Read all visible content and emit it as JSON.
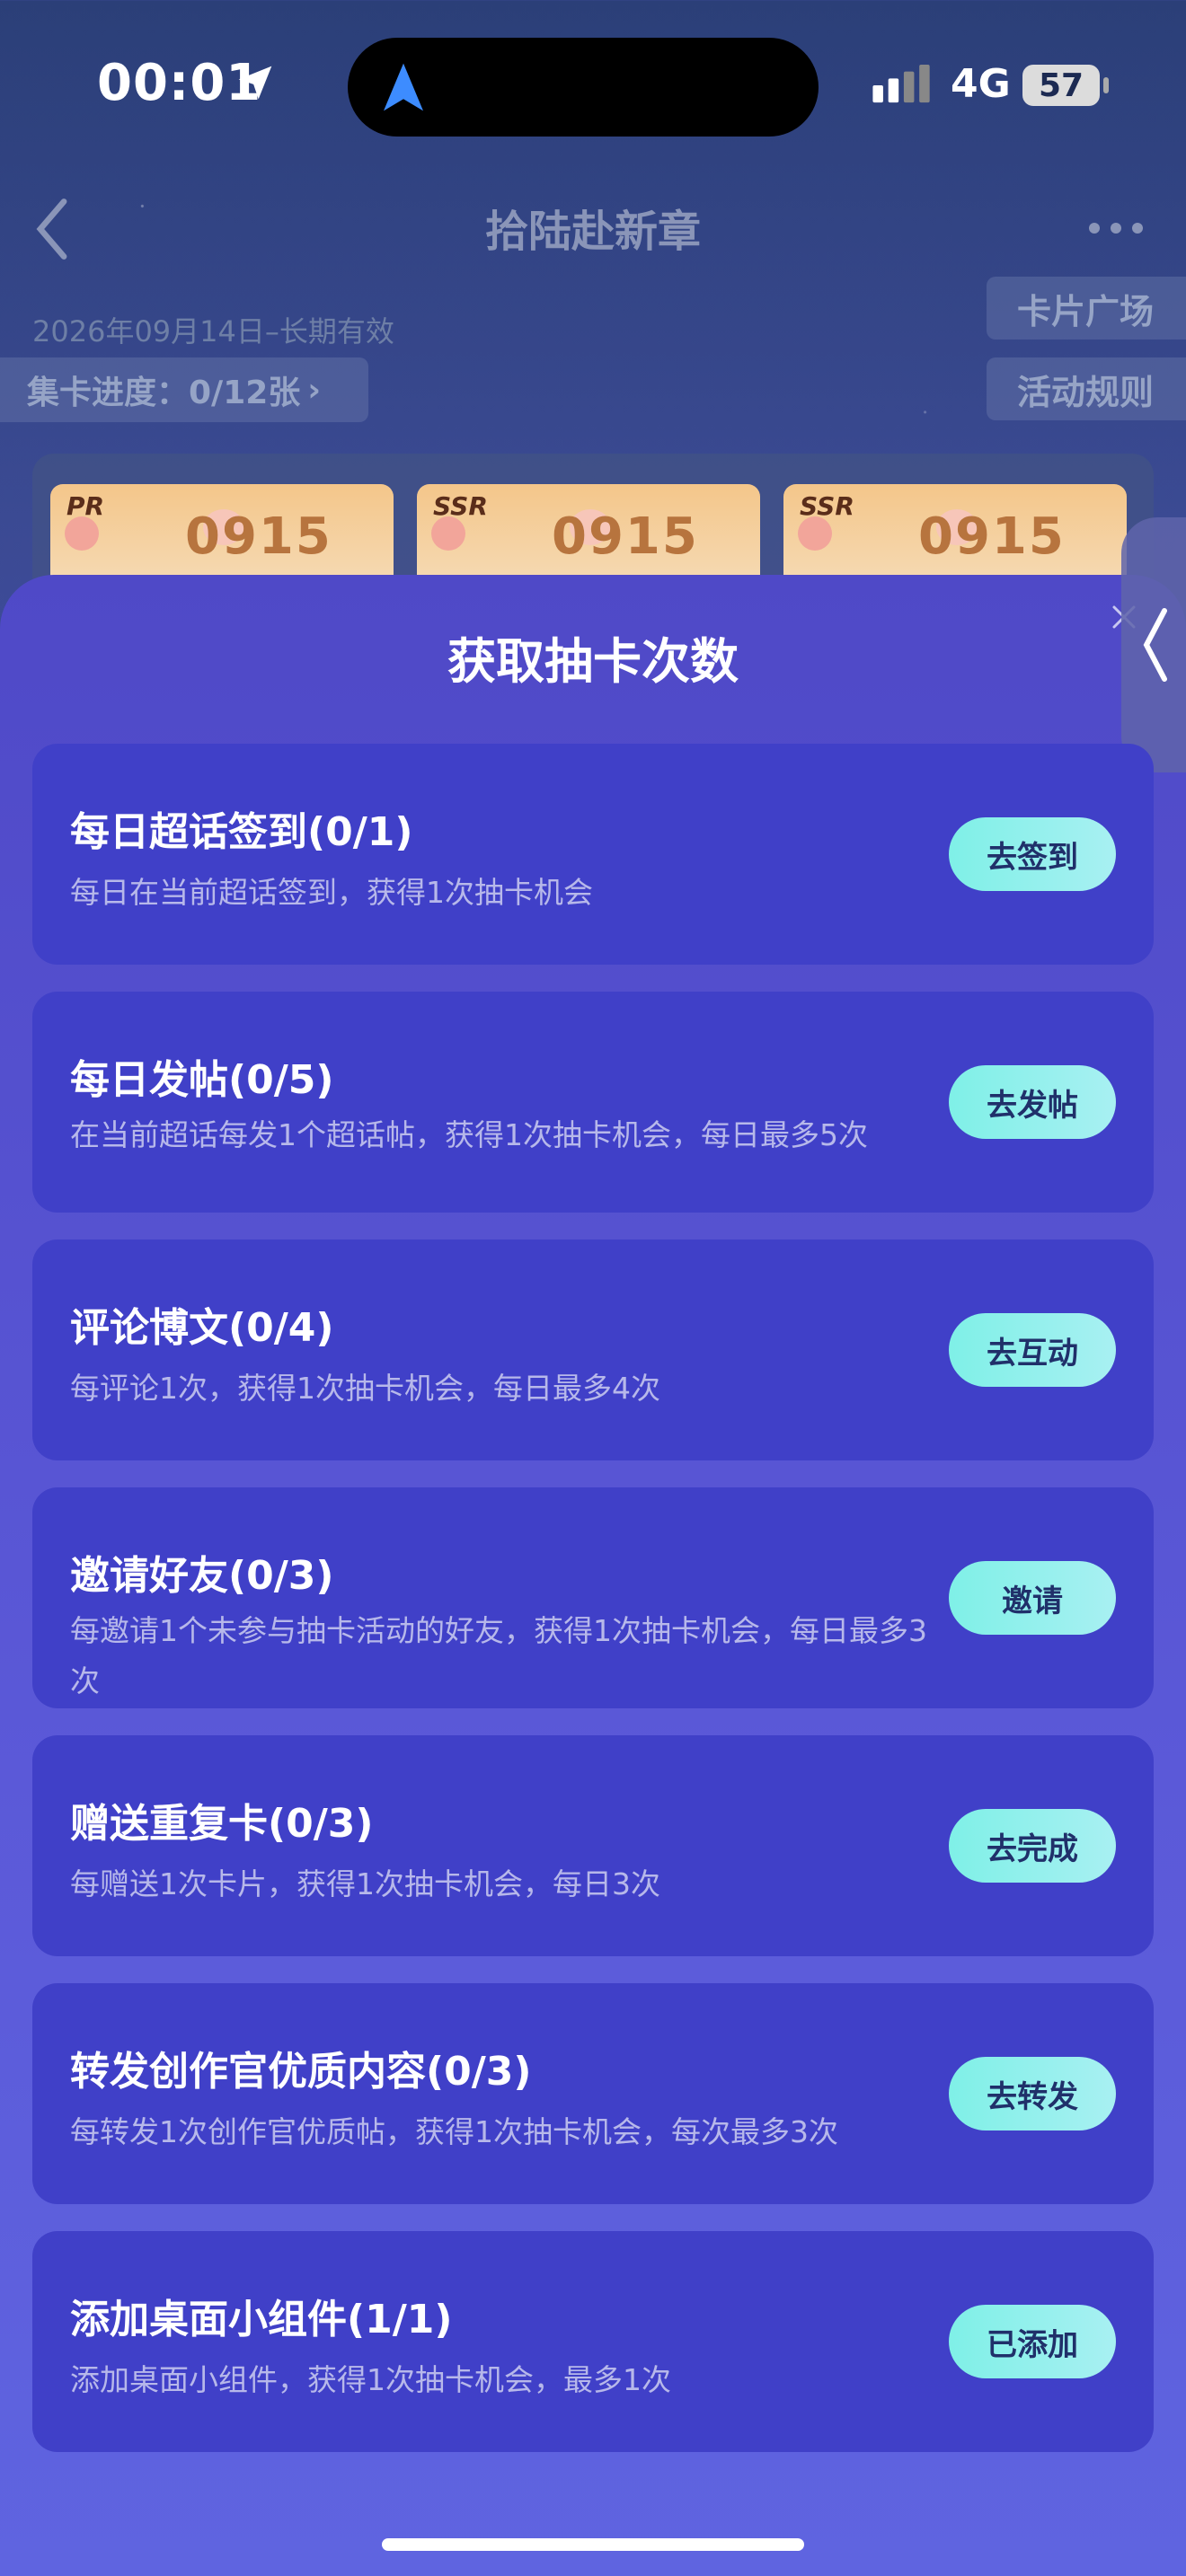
{
  "status_bar": {
    "time": "00:01",
    "network": "4G",
    "battery": "57"
  },
  "header": {
    "title": "拾陆赴新章",
    "date_range": "2026年09月14日–长期有效",
    "card_plaza": "卡片广场",
    "rules": "活动规则",
    "progress": "集卡进度：0/12张"
  },
  "cards": [
    {
      "rarity": "PR",
      "art": "0915"
    },
    {
      "rarity": "SSR",
      "art": "0915"
    },
    {
      "rarity": "SSR",
      "art": "0915"
    }
  ],
  "sheet": {
    "title": "获取抽卡次数",
    "tasks": [
      {
        "name": "每日超话签到(0/1)",
        "desc": "每日在当前超话签到，获得1次抽卡机会",
        "button": "去签到"
      },
      {
        "name": "每日发帖(0/5)",
        "desc": "在当前超话每发1个超话帖，获得1次抽卡机会，每日最多5次",
        "button": "去发帖"
      },
      {
        "name": "评论博文(0/4)",
        "desc": "每评论1次，获得1次抽卡机会，每日最多4次",
        "button": "去互动"
      },
      {
        "name": "邀请好友(0/3)",
        "desc": "每邀请1个未参与抽卡活动的好友，获得1次抽卡机会，每日最多3次",
        "button": "邀请"
      },
      {
        "name": "赠送重复卡(0/3)",
        "desc": "每赠送1次卡片，获得1次抽卡机会，每日3次",
        "button": "去完成"
      },
      {
        "name": "转发创作官优质内容(0/3)",
        "desc": "每转发1次创作官优质帖，获得1次抽卡机会，每次最多3次",
        "button": "去转发"
      },
      {
        "name": "添加桌面小组件(1/1)",
        "desc": "添加桌面小组件，获得1次抽卡机会，最多1次",
        "button": "已添加"
      }
    ]
  },
  "icons": {
    "location": "location-arrow-icon",
    "back": "chevron-left-icon",
    "more": "more-dots-icon",
    "close": "close-icon",
    "side": "chevron-left-icon"
  }
}
